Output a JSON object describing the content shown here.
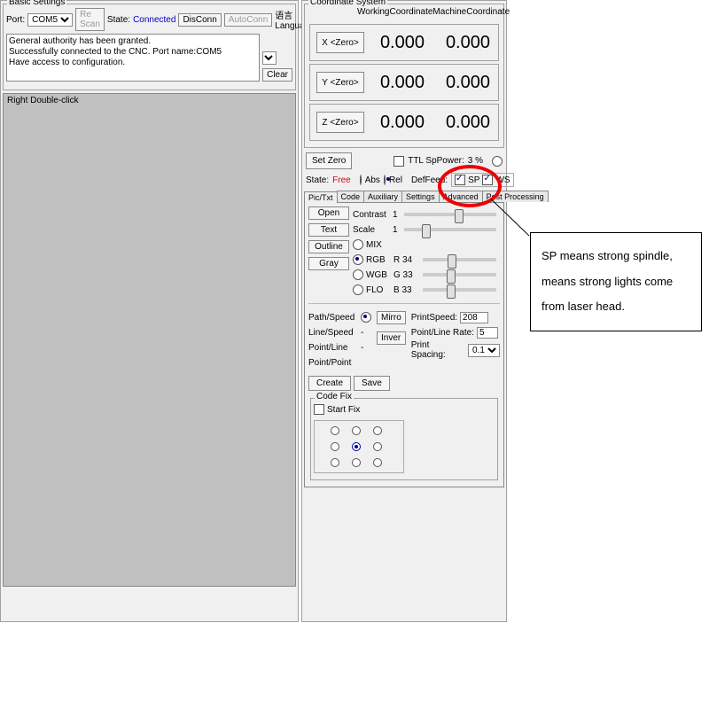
{
  "basic": {
    "title": "Basic Settings",
    "port_label": "Port:",
    "port_value": "COM5",
    "rescan": "Re Scan",
    "state_label": "State:",
    "state_value": "Connected",
    "disconn": "DisConn",
    "autoconn": "AutoConn",
    "lang_label": "语言 Language",
    "log_line1": "General authority has been granted.",
    "log_line2": "Successfully connected to the CNC. Port name:COM5",
    "log_line3": "Have access to configuration.",
    "clear": "Clear"
  },
  "canvas": {
    "hint": "Right Double-click"
  },
  "coord": {
    "title": "Coordinate System",
    "working": "WorkingCoordinate",
    "machine": "MachineCoordinate",
    "x_btn": "X <Zero>",
    "y_btn": "Y <Zero>",
    "z_btn": "Z <Zero>",
    "x_work": "0.000",
    "x_mach": "0.000",
    "y_work": "0.000",
    "y_mach": "0.000",
    "z_work": "0.000",
    "z_mach": "0.000"
  },
  "zero": {
    "setzero": "Set Zero",
    "ttl_label": "TTL SpPower:",
    "ttl_value": "3 %",
    "state_label": "State:",
    "state_value": "Free",
    "abs": "Abs",
    "rel": "Rel",
    "deffeed": "DefFeed:",
    "sp": "SP",
    "ws": "WS"
  },
  "tabs": {
    "t1": "Pic/Txt",
    "t2": "Code",
    "t3": "Auxiliary",
    "t4": "Settings",
    "t5": "Advanced",
    "t6": "Post Processing"
  },
  "pic": {
    "open": "Open",
    "text": "Text",
    "outline": "Outline",
    "gray": "Gray",
    "contrast": "Contrast",
    "contrast_v": "1",
    "scale": "Scale",
    "scale_v": "1",
    "mix": "MIX",
    "rgb": "RGB",
    "wgb": "WGB",
    "flo": "FLO",
    "r_label": "R 34",
    "g_label": "G 33",
    "b_label": "B 33"
  },
  "path": {
    "pathspeed": "Path/Speed",
    "linespeed": "Line/Speed",
    "pointline": "Point/Line",
    "pointpoint": "Point/Point",
    "mirror": "Mirro",
    "inver": "Inver",
    "printspeed_l": "PrintSpeed:",
    "printspeed_v": "208",
    "plrate_l": "Point/Line Rate:",
    "plrate_v": "5",
    "spacing_l": "Print Spacing:",
    "spacing_v": "0.1",
    "create": "Create",
    "save": "Save"
  },
  "codefix": {
    "title": "Code Fix",
    "startfix": "Start Fix"
  },
  "callout": {
    "text": "SP means strong spindle, means strong lights come from laser head."
  }
}
